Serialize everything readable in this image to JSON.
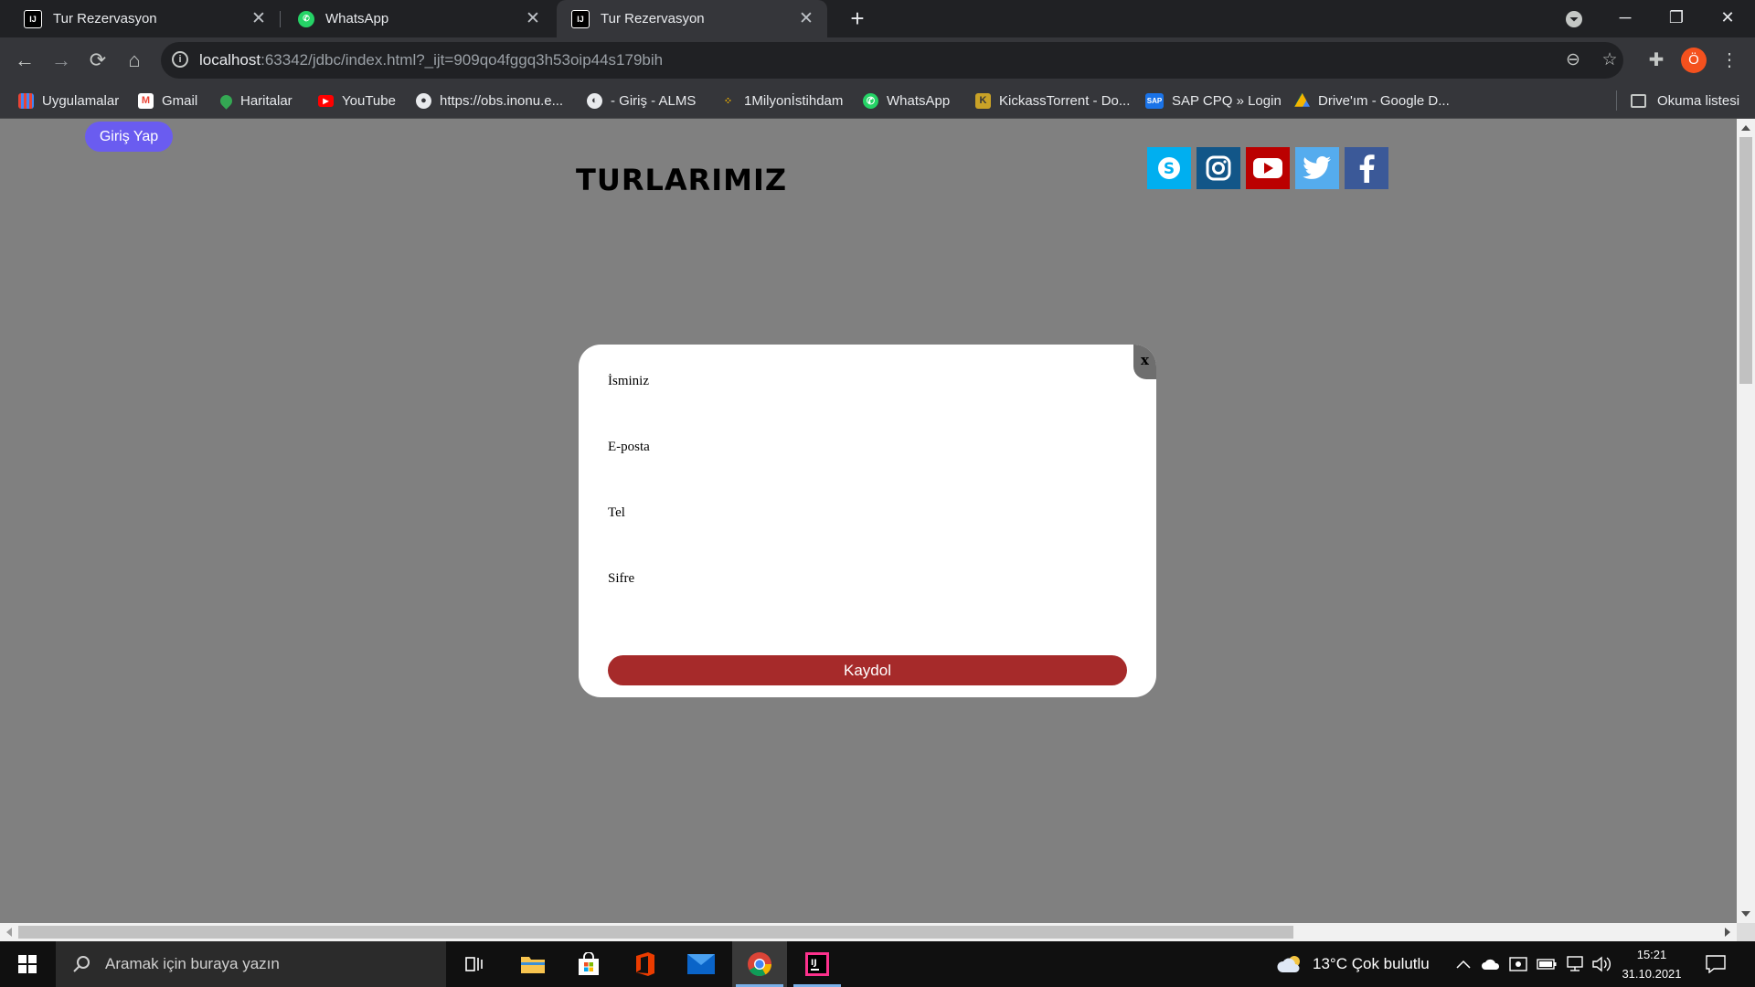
{
  "browser": {
    "tabs": [
      {
        "title": "Tur Rezervasyon",
        "icon": "intellij-icon",
        "active": false
      },
      {
        "title": "WhatsApp",
        "icon": "whatsapp-icon",
        "active": false
      },
      {
        "title": "Tur Rezervasyon",
        "icon": "intellij-icon",
        "active": true
      }
    ],
    "address": {
      "host": "localhost",
      "rest": ":63342/jdbc/index.html?_ijt=909qo4fggq3h53oip44s179bih"
    },
    "profile_initial": "Ö",
    "bookmarks": [
      {
        "label": "Uygulamalar",
        "icon": "apps-grid-icon"
      },
      {
        "label": "Gmail",
        "icon": "gmail-icon"
      },
      {
        "label": "Haritalar",
        "icon": "maps-pin-icon"
      },
      {
        "label": "YouTube",
        "icon": "youtube-icon"
      },
      {
        "label": "https://obs.inonu.e...",
        "icon": "globe-icon"
      },
      {
        "label": "- Giriş - ALMS",
        "icon": "alms-icon"
      },
      {
        "label": "1Milyonİstihdam",
        "icon": "dots-icon"
      },
      {
        "label": "WhatsApp",
        "icon": "whatsapp-icon"
      },
      {
        "label": "KickassTorrent - Do...",
        "icon": "kickass-icon"
      },
      {
        "label": "SAP CPQ » Login",
        "icon": "sap-icon"
      },
      {
        "label": "Drive'ım - Google D...",
        "icon": "drive-icon"
      }
    ],
    "reading_list": "Okuma listesi"
  },
  "page": {
    "login_button": "Giriş Yap",
    "heading": "TURLARIMIZ",
    "social": [
      {
        "name": "skype",
        "color": "#00aff0"
      },
      {
        "name": "instagram",
        "color": "#125688"
      },
      {
        "name": "youtube",
        "color": "#bb0000"
      },
      {
        "name": "twitter",
        "color": "#55acee"
      },
      {
        "name": "facebook",
        "color": "#3b5998"
      }
    ],
    "modal": {
      "close": "x",
      "fields": [
        {
          "label": "İsminiz"
        },
        {
          "label": "E-posta"
        },
        {
          "label": "Tel"
        },
        {
          "label": "Sifre"
        }
      ],
      "submit": "Kaydol",
      "submit_color": "#a62a2a"
    }
  },
  "taskbar": {
    "search_placeholder": "Aramak için buraya yazın",
    "weather": "13°C  Çok bulutlu",
    "time": "15:21",
    "date": "31.10.2021"
  }
}
